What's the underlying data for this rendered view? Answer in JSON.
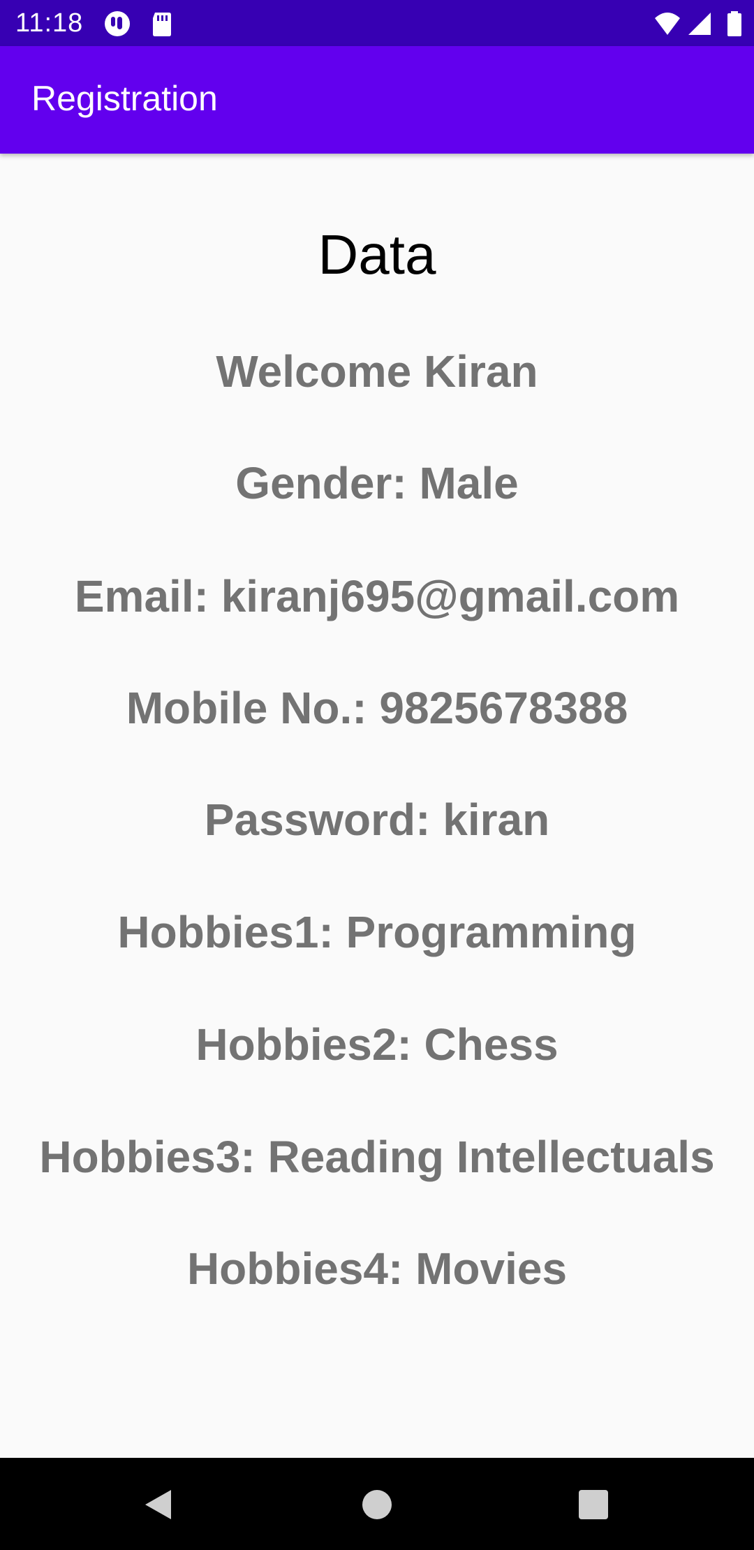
{
  "status_bar": {
    "time": "11:18",
    "icons": [
      "notification-app-icon",
      "sd-card-icon",
      "wifi-icon",
      "signal-icon",
      "battery-icon"
    ]
  },
  "app_bar": {
    "title": "Registration"
  },
  "main": {
    "heading": "Data",
    "welcome": "Welcome Kiran",
    "gender": "Gender: Male",
    "email": "Email: kiranj695@gmail.com",
    "mobile": "Mobile No.: 9825678388",
    "password": "Password: kiran",
    "hobby1": "Hobbies1: Programming",
    "hobby2": "Hobbies2: Chess",
    "hobby3": "Hobbies3: Reading Intellectuals",
    "hobby4": "Hobbies4: Movies"
  },
  "nav_bar": {
    "buttons": [
      "back-icon",
      "home-icon",
      "recents-icon"
    ]
  },
  "colors": {
    "status_bar": "#3700b3",
    "app_bar": "#6200ee",
    "background": "#fafafa",
    "text_gray": "#737373"
  }
}
